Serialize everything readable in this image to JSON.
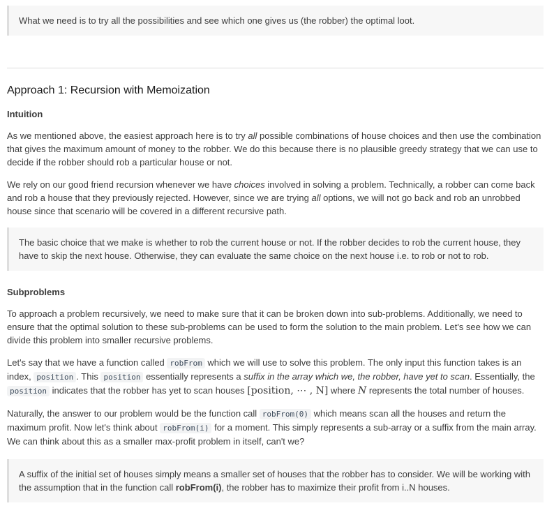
{
  "quote_top": "What we need is to try all the possibilities and see which one gives us (the robber) the optimal loot.",
  "heading": "Approach 1: Recursion with Memoization",
  "intuition_heading": "Intuition",
  "p1": {
    "a": "As we mentioned above, the easiest approach here is to try ",
    "em": "all",
    "b": " possible combinations of house choices and then use the combination that gives the maximum amount of money to the robber. We do this because there is no plausible greedy strategy that we can use to decide if the robber should rob a particular house or not."
  },
  "p2": {
    "a": "We rely on our good friend recursion whenever we have ",
    "em1": "choices",
    "b": " involved in solving a problem. Technically, a robber can come back and rob a house that they previously rejected. However, since we are trying ",
    "em2": "all",
    "c": " options, we will not go back and rob an unrobbed house since that scenario will be covered in a different recursive path."
  },
  "quote_mid": "The basic choice that we make is whether to rob the current house or not. If the robber decides to rob the current house, they have to skip the next house. Otherwise, they can evaluate the same choice on the next house i.e. to rob or not to rob.",
  "subproblems_heading": "Subproblems",
  "p3": "To approach a problem recursively, we need to make sure that it can be broken down into sub-problems. Additionally, we need to ensure that the optimal solution to these sub-problems can be used to form the solution to the main problem. Let's see how we can divide this problem into smaller recursive problems.",
  "p4": {
    "a": "Let's say that we have a function called ",
    "code1": "robFrom",
    "b": " which we will use to solve this problem. The only input this function takes is an index, ",
    "code2": "position",
    "c": ". This ",
    "code3": "position",
    "d": " essentially represents a ",
    "em": "suffix in the array which we, the robber, have yet to scan",
    "e": ". Essentially, the ",
    "code4": "position",
    "f": " indicates that the robber has yet to scan houses ",
    "math1": "[position, ⋯ , N]",
    "g": " where ",
    "math2": "N",
    "h": " represents the total number of houses."
  },
  "p5": {
    "a": "Naturally, the answer to our problem would be the function call ",
    "code1": "robFrom(0)",
    "b": " which means scan all the houses and return the maximum profit. Now let's think about ",
    "code2": "robFrom(i)",
    "c": " for a moment. This simply represents a sub-array or a suffix from the main array. We can think about this as a smaller max-profit problem in itself, can't we?"
  },
  "quote_last": {
    "a": "A suffix of the initial set of houses simply means a smaller set of houses that the robber has to consider. We will be working with the assumption that in the function call ",
    "strong": "robFrom(i)",
    "b": ", the robber has to maximize their profit from i..N houses."
  }
}
